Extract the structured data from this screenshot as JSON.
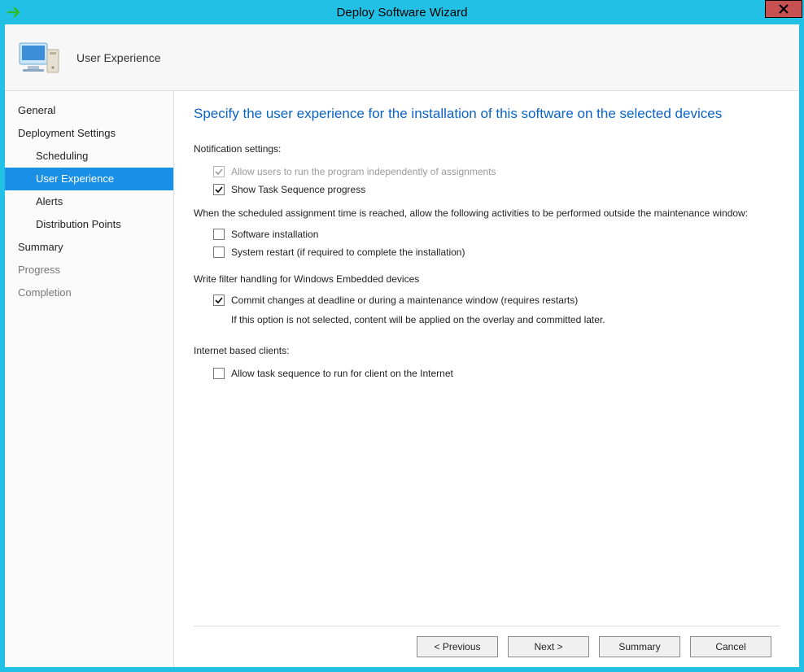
{
  "window": {
    "title": "Deploy Software Wizard"
  },
  "header": {
    "page_title": "User Experience"
  },
  "sidebar": {
    "items": [
      {
        "label": "General",
        "indent": false,
        "selected": false,
        "disabled": false
      },
      {
        "label": "Deployment Settings",
        "indent": false,
        "selected": false,
        "disabled": false
      },
      {
        "label": "Scheduling",
        "indent": true,
        "selected": false,
        "disabled": false
      },
      {
        "label": "User Experience",
        "indent": true,
        "selected": true,
        "disabled": false
      },
      {
        "label": "Alerts",
        "indent": true,
        "selected": false,
        "disabled": false
      },
      {
        "label": "Distribution Points",
        "indent": true,
        "selected": false,
        "disabled": false
      },
      {
        "label": "Summary",
        "indent": false,
        "selected": false,
        "disabled": false
      },
      {
        "label": "Progress",
        "indent": false,
        "selected": false,
        "disabled": true
      },
      {
        "label": "Completion",
        "indent": false,
        "selected": false,
        "disabled": true
      }
    ]
  },
  "main": {
    "heading": "Specify the user experience for the installation of this software on the selected devices",
    "notification_label": "Notification settings:",
    "cb_allow_independent": "Allow users to run the program independently of assignments",
    "cb_show_progress": "Show Task Sequence progress",
    "maintenance_para": "When the scheduled assignment time is reached, allow the following activities to be performed outside the maintenance window:",
    "cb_software_install": "Software installation",
    "cb_system_restart": "System restart (if required to complete the installation)",
    "write_filter_label": "Write filter handling for Windows Embedded devices",
    "cb_commit_changes": "Commit changes at deadline or during a maintenance window (requires restarts)",
    "commit_note": "If this option is not selected, content will be applied on the overlay and committed later.",
    "internet_label": "Internet based clients:",
    "cb_internet": "Allow task sequence to run for client on the Internet"
  },
  "buttons": {
    "previous": "< Previous",
    "next": "Next >",
    "summary": "Summary",
    "cancel": "Cancel"
  },
  "checkbox_state": {
    "allow_independent": {
      "checked": true,
      "disabled": true
    },
    "show_progress": {
      "checked": true,
      "disabled": false
    },
    "software_install": {
      "checked": false,
      "disabled": false
    },
    "system_restart": {
      "checked": false,
      "disabled": false
    },
    "commit_changes": {
      "checked": true,
      "disabled": false
    },
    "internet": {
      "checked": false,
      "disabled": false
    }
  }
}
